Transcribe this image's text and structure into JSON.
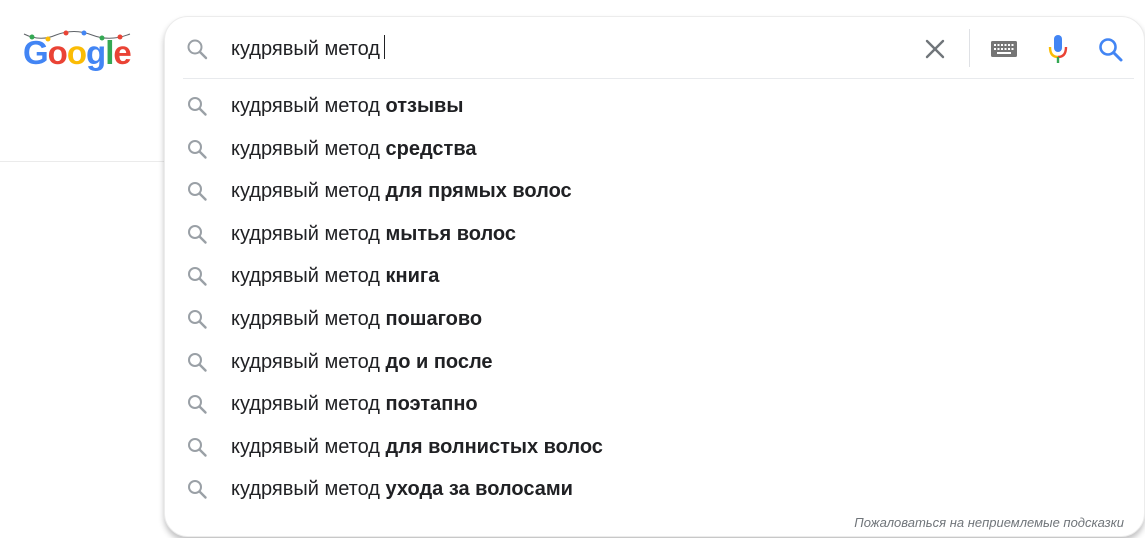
{
  "logo": {
    "text": "Google",
    "colors": [
      "#4285F4",
      "#EA4335",
      "#FBBC05",
      "#4285F4",
      "#34A853",
      "#EA4335"
    ]
  },
  "search": {
    "value": "кудрявый метод",
    "icons": [
      "search-icon",
      "close-icon",
      "keyboard-icon",
      "microphone-icon",
      "search-icon"
    ]
  },
  "suggestions": [
    {
      "prefix": "кудрявый метод ",
      "completion": "отзывы"
    },
    {
      "prefix": "кудрявый метод ",
      "completion": "средства"
    },
    {
      "prefix": "кудрявый метод ",
      "completion": "для прямых волос"
    },
    {
      "prefix": "кудрявый метод ",
      "completion": "мытья волос"
    },
    {
      "prefix": "кудрявый метод ",
      "completion": "книга"
    },
    {
      "prefix": "кудрявый метод ",
      "completion": "пошагово"
    },
    {
      "prefix": "кудрявый метод ",
      "completion": "до и после"
    },
    {
      "prefix": "кудрявый метод ",
      "completion": "поэтапно"
    },
    {
      "prefix": "кудрявый метод ",
      "completion": "для волнистых волос"
    },
    {
      "prefix": "кудрявый метод ",
      "completion": "ухода за волосами"
    }
  ],
  "footer": {
    "report_label": "Пожаловаться на неприемлемые подсказки"
  },
  "colors": {
    "text": "#202124",
    "muted_icon": "#9aa0a6",
    "accent_blue": "#4285F4"
  }
}
